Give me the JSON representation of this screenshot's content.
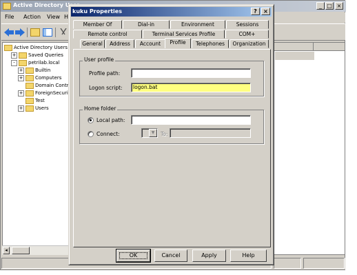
{
  "mmc": {
    "title": "Active Directory User",
    "menu": [
      "File",
      "Action",
      "View",
      "Hel"
    ],
    "tree": [
      {
        "label": "Active Directory Users a",
        "indent": 0,
        "expander": ""
      },
      {
        "label": "Saved Queries",
        "indent": 1,
        "expander": "+"
      },
      {
        "label": "petrilab.local",
        "indent": 1,
        "expander": "-"
      },
      {
        "label": "Builtin",
        "indent": 2,
        "expander": "+"
      },
      {
        "label": "Computers",
        "indent": 2,
        "expander": "+"
      },
      {
        "label": "Domain Controlle",
        "indent": 2,
        "expander": ""
      },
      {
        "label": "ForeignSecurityP",
        "indent": 2,
        "expander": "+"
      },
      {
        "label": "Test",
        "indent": 2,
        "expander": ""
      },
      {
        "label": "Users",
        "indent": 2,
        "expander": "+"
      }
    ],
    "window_controls": {
      "minimize": "_",
      "maximize": "□",
      "close": "×"
    }
  },
  "dialog": {
    "title": "kuku Properties",
    "title_buttons": {
      "help": "?",
      "close": "×"
    },
    "tabs_row1": [
      "Member Of",
      "Dial-in",
      "Environment",
      "Sessions"
    ],
    "tabs_row2": [
      "Remote control",
      "Terminal Services Profile",
      "COM+"
    ],
    "tabs_row3": [
      "General",
      "Address",
      "Account",
      "Profile",
      "Telephones",
      "Organization"
    ],
    "active_tab": "Profile",
    "user_profile": {
      "legend": "User profile",
      "profile_path_label": "Profile path:",
      "profile_path_value": "",
      "logon_script_label": "Logon script:",
      "logon_script_value": "logon.bat"
    },
    "home_folder": {
      "legend": "Home folder",
      "local_path_label": "Local path:",
      "local_path_value": "",
      "local_path_selected": true,
      "connect_label": "Connect:",
      "connect_drive": "",
      "to_label": "To:",
      "to_value": ""
    },
    "buttons": {
      "ok": "OK",
      "cancel": "Cancel",
      "apply": "Apply",
      "help": "Help"
    }
  },
  "colors": {
    "dialog_titlebar": "#0a246a",
    "inactive_titlebar": "#9ba5b4",
    "highlight_field": "#ffff80",
    "face": "#d4d0c8"
  }
}
